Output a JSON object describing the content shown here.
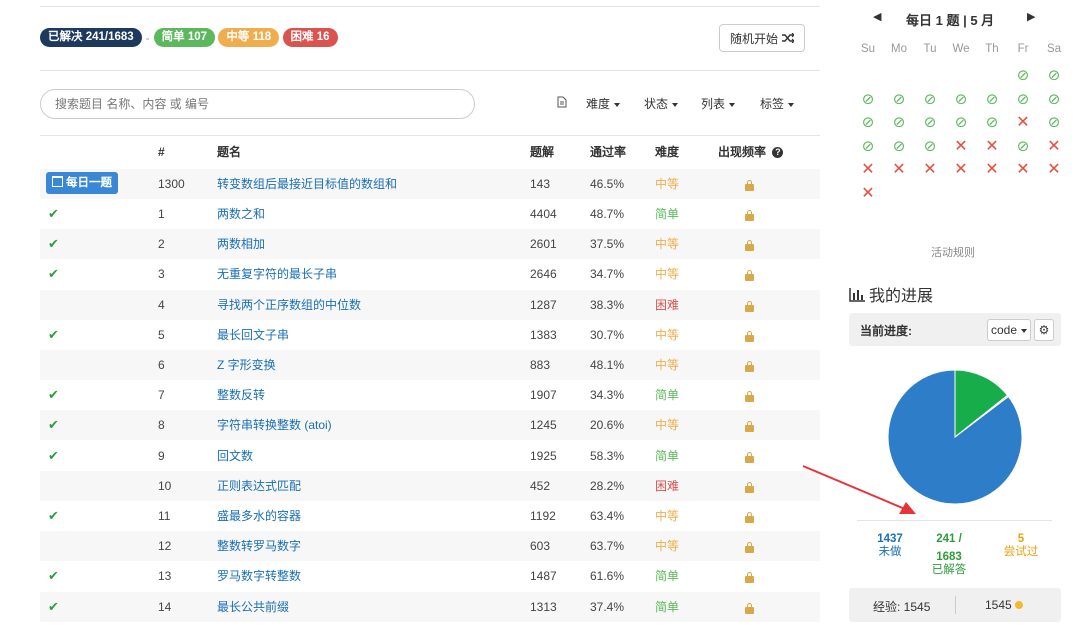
{
  "colors": {
    "link": "#1a6fb5",
    "easy": "#5cb85c",
    "medium": "#f0ad4e",
    "hard": "#d9534f",
    "solved_check": "#2e9c3c",
    "pie_blue": "#2d7dc9",
    "pie_green": "#18ad4b"
  },
  "badges": {
    "solved": "已解决 241/1683",
    "sep": "-",
    "easy": "简单 107",
    "medium": "中等 118",
    "hard": "困难 16"
  },
  "random_button": {
    "label": "随机开始",
    "icon": "shuffle-icon"
  },
  "search": {
    "placeholder": "搜索题目 名称、内容 或 编号"
  },
  "filters": {
    "difficulty": "难度",
    "status": "状态",
    "list": "列表",
    "tags": "标签",
    "file_icon": "document-icon"
  },
  "table": {
    "headers": {
      "num": "#",
      "title": "题名",
      "solutions": "题解",
      "acceptance": "通过率",
      "difficulty": "难度",
      "frequency": "出现频率"
    },
    "daily": {
      "label": "每日一题",
      "num": "1300",
      "title": "转变数组后最接近目标值的数组和",
      "solutions": "143",
      "acceptance": "46.5%",
      "difficulty": "中等"
    },
    "rows": [
      {
        "solved": true,
        "num": "1",
        "title": "两数之和",
        "solutions": "4404",
        "acceptance": "48.7%",
        "difficulty": "简单"
      },
      {
        "solved": true,
        "num": "2",
        "title": "两数相加",
        "solutions": "2601",
        "acceptance": "37.5%",
        "difficulty": "中等"
      },
      {
        "solved": true,
        "num": "3",
        "title": "无重复字符的最长子串",
        "solutions": "2646",
        "acceptance": "34.7%",
        "difficulty": "中等"
      },
      {
        "solved": false,
        "num": "4",
        "title": "寻找两个正序数组的中位数",
        "solutions": "1287",
        "acceptance": "38.3%",
        "difficulty": "困难"
      },
      {
        "solved": true,
        "num": "5",
        "title": "最长回文子串",
        "solutions": "1383",
        "acceptance": "30.7%",
        "difficulty": "中等"
      },
      {
        "solved": false,
        "num": "6",
        "title": "Z 字形变换",
        "solutions": "883",
        "acceptance": "48.1%",
        "difficulty": "中等"
      },
      {
        "solved": true,
        "num": "7",
        "title": "整数反转",
        "solutions": "1907",
        "acceptance": "34.3%",
        "difficulty": "简单"
      },
      {
        "solved": true,
        "num": "8",
        "title": "字符串转换整数 (atoi)",
        "solutions": "1245",
        "acceptance": "20.6%",
        "difficulty": "中等"
      },
      {
        "solved": true,
        "num": "9",
        "title": "回文数",
        "solutions": "1925",
        "acceptance": "58.3%",
        "difficulty": "简单"
      },
      {
        "solved": false,
        "num": "10",
        "title": "正则表达式匹配",
        "solutions": "452",
        "acceptance": "28.2%",
        "difficulty": "困难"
      },
      {
        "solved": true,
        "num": "11",
        "title": "盛最多水的容器",
        "solutions": "1192",
        "acceptance": "63.4%",
        "difficulty": "中等"
      },
      {
        "solved": false,
        "num": "12",
        "title": "整数转罗马数字",
        "solutions": "603",
        "acceptance": "63.7%",
        "difficulty": "中等"
      },
      {
        "solved": true,
        "num": "13",
        "title": "罗马数字转整数",
        "solutions": "1487",
        "acceptance": "61.6%",
        "difficulty": "简单"
      },
      {
        "solved": true,
        "num": "14",
        "title": "最长公共前缀",
        "solutions": "1313",
        "acceptance": "37.4%",
        "difficulty": "简单"
      }
    ]
  },
  "calendar": {
    "title": "每日 1 题 | 5 月",
    "prev": "◀",
    "next": "▶",
    "weekdays": [
      "Su",
      "Mo",
      "Tu",
      "We",
      "Th",
      "Fr",
      "Sa"
    ],
    "weeks": [
      [
        "",
        "",
        "",
        "",
        "",
        "ok",
        "ok"
      ],
      [
        "ok",
        "ok",
        "ok",
        "ok",
        "ok",
        "ok",
        "ok"
      ],
      [
        "ok",
        "ok",
        "ok",
        "ok",
        "ok",
        "x",
        "ok"
      ],
      [
        "ok",
        "ok",
        "ok",
        "x",
        "x",
        "ok",
        "x"
      ],
      [
        "x",
        "x",
        "x",
        "x",
        "x",
        "x",
        "x"
      ],
      [
        "x",
        "",
        "",
        "",
        "",
        "",
        ""
      ]
    ],
    "ok_glyph": "⊘",
    "x_glyph": "✕",
    "rules": "活动规则"
  },
  "progress": {
    "heading": "我的进展",
    "current_label": "当前进度:",
    "code_select": "code",
    "pie_fractions": {
      "unsolved": 0.8533,
      "solved": 0.1432,
      "attempted": 0.0035
    },
    "unsolved_value": "1437",
    "unsolved_label": "未做",
    "solved_value_a": "241 /",
    "solved_value_b": "1683",
    "solved_label": "已解答",
    "attempted_value": "5",
    "attempted_label": "尝试过",
    "exp_label": "经验: 1545",
    "coins": "1545"
  }
}
